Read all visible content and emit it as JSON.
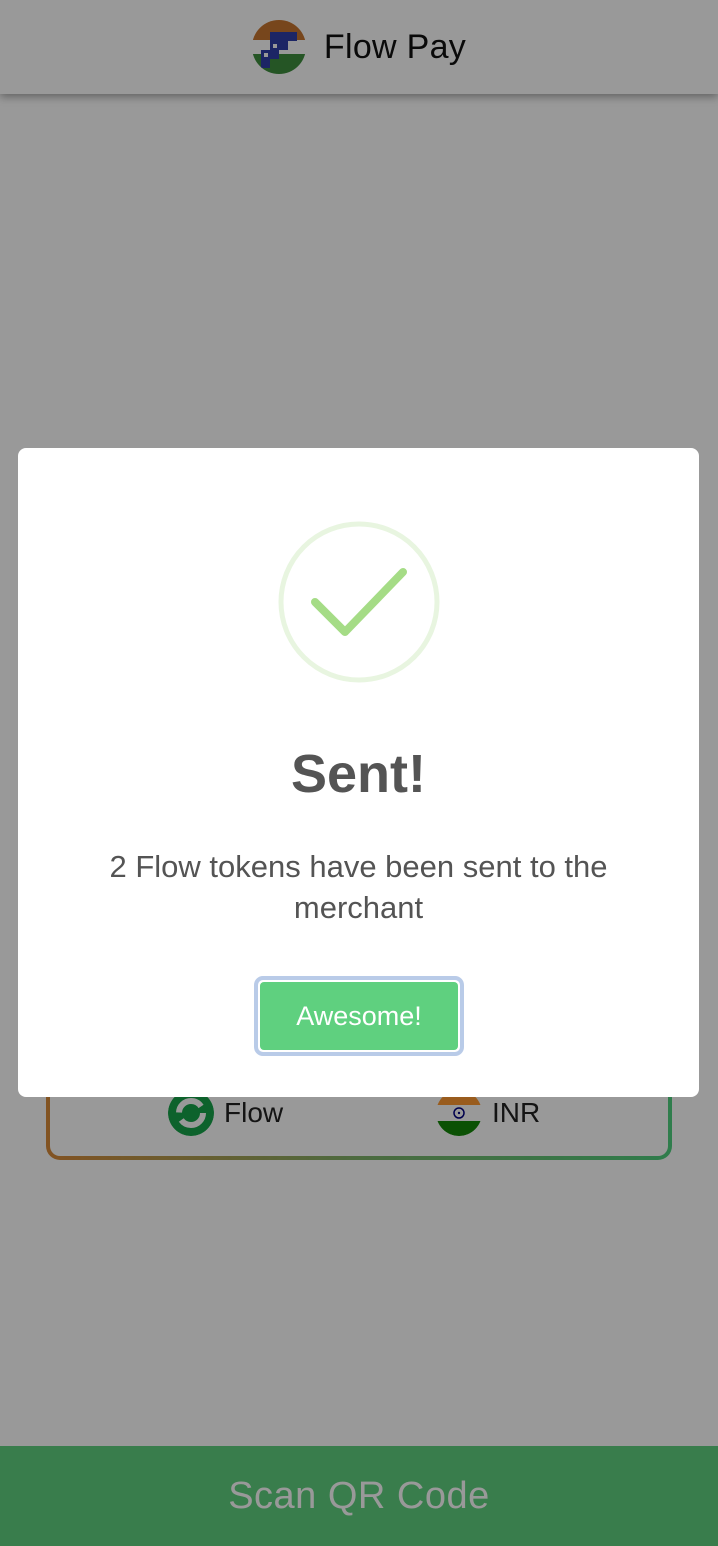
{
  "header": {
    "logo_icon": "flow-pay-logo-icon",
    "title": "Flow Pay"
  },
  "currencies": {
    "from": {
      "label": "Flow",
      "icon": "flow-coin-icon"
    },
    "to": {
      "label": "INR",
      "icon": "india-flag-icon"
    }
  },
  "scan_button": {
    "label": "Scan QR Code"
  },
  "dialog": {
    "icon": "success-check-icon",
    "title": "Sent!",
    "message": "2 Flow tokens have been sent to the merchant",
    "confirm_label": "Awesome!"
  },
  "colors": {
    "accent_green": "#5fd07f",
    "success_check": "#a5dc86",
    "dialog_text": "#545454",
    "backdrop": "rgba(0,0,0,0.4)"
  }
}
